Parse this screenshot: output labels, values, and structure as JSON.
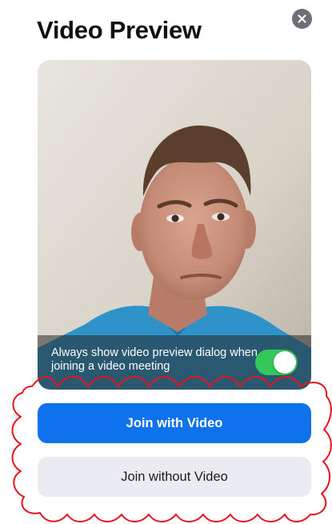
{
  "dialog": {
    "title": "Video Preview",
    "close_icon": "close-icon"
  },
  "preview": {
    "always_show_label": "Always show video preview dialog when joining a video meeting",
    "always_show_enabled": true
  },
  "buttons": {
    "join_with_video": "Join with Video",
    "join_without_video": "Join without Video"
  },
  "colors": {
    "primary": "#0e72ed",
    "toggle_on": "#34c759",
    "secondary_button": "#ebebf2",
    "annotation": "#e8141b"
  }
}
